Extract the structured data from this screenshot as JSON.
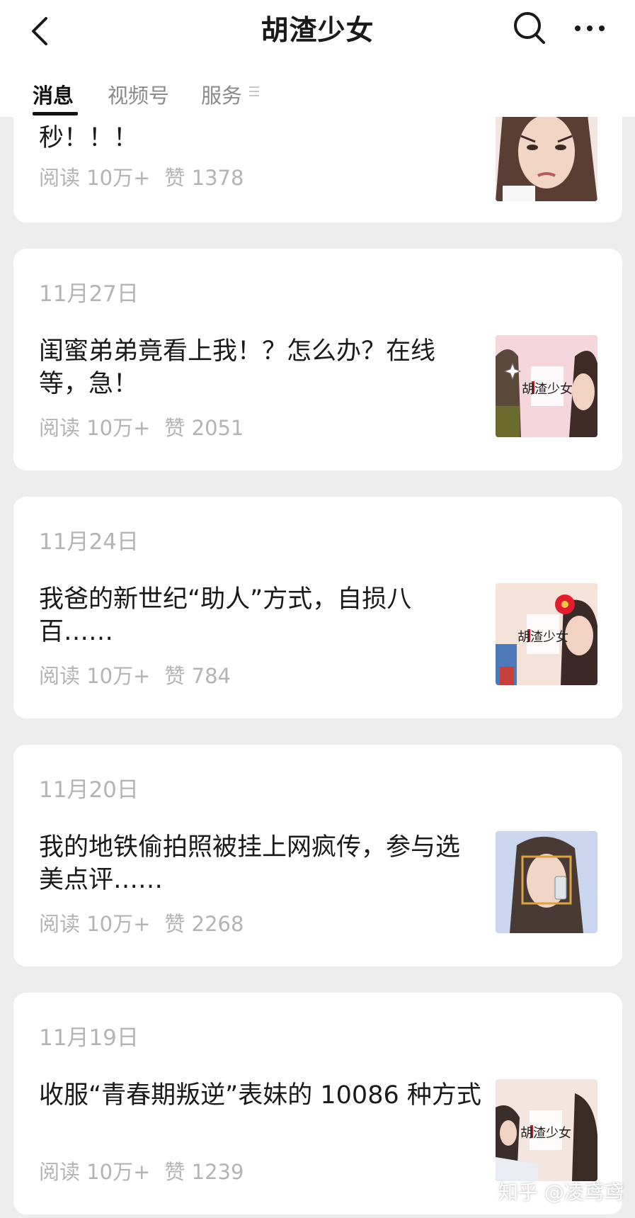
{
  "header": {
    "title": "胡渣少女"
  },
  "tabs": [
    {
      "label": "消息",
      "active": true
    },
    {
      "label": "视频号",
      "active": false
    },
    {
      "label": "服务",
      "active": false
    }
  ],
  "articles": [
    {
      "date": "",
      "title": "秒！！！",
      "reads": "阅读 10万+",
      "likes": "赞 1378"
    },
    {
      "date": "11月27日",
      "title": "闺蜜弟弟竟看上我！？怎么办？在线等，急！",
      "reads": "阅读 10万+",
      "likes": "赞 2051"
    },
    {
      "date": "11月24日",
      "title": "我爸的新世纪“助人”方式，自损八百……",
      "reads": "阅读 10万+",
      "likes": "赞 784"
    },
    {
      "date": "11月20日",
      "title": "我的地铁偷拍照被挂上网疯传，参与选美点评……",
      "reads": "阅读 10万+",
      "likes": "赞 2268"
    },
    {
      "date": "11月19日",
      "title": "收服“青春期叛逆”表妹的 10086 种方式",
      "reads": "阅读 10万+",
      "likes": "赞 1239"
    }
  ],
  "thumb_badge_text": "胡渣少女",
  "watermark": "知乎 @凌鸢鸢",
  "colors": {
    "background": "#ededed",
    "card": "#ffffff",
    "meta_text": "#b4b4b4",
    "title_text": "#1a1a1a"
  }
}
